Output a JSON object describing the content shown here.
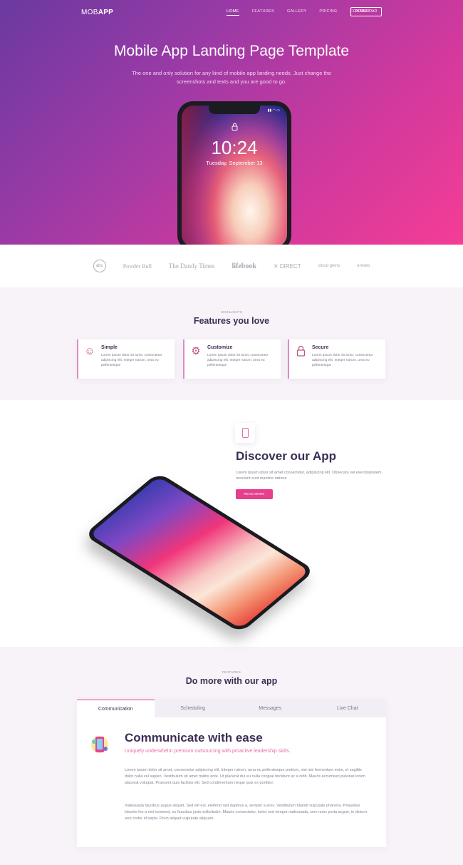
{
  "nav": {
    "logo_light": "MOB",
    "logo_bold": "APP",
    "links": [
      "HOME",
      "FEATURES",
      "GALLERY",
      "PRICING",
      "CONTACT"
    ],
    "download": "DOWNLOAD"
  },
  "hero": {
    "title": "Mobile App Landing Page Template",
    "subtitle": "The one and only solution for any kind of mobile app landing needs. Just change the screenshots and texts and you are good to go.",
    "phone_time": "10:24",
    "phone_date": "Tuesday, September 13",
    "phone_status": "▮▮ ◠ ▭",
    "lock_icon": "lock-icon"
  },
  "logos": [
    "abc",
    "Powder Bull",
    "The Dandy Times",
    "lifebook",
    "✕ DIRECT",
    "cloud gems",
    "envato"
  ],
  "features": {
    "small": "HIGHLIGHTS",
    "title": "Features you love",
    "items": [
      {
        "icon": "smile-icon",
        "glyph": "☺",
        "title": "Simple",
        "text": "Lorem ipsum dolor sit amet, consectetur adipiscing elit. Integer rutrum, urna eu pellentesque"
      },
      {
        "icon": "gear-icon",
        "glyph": "⚙",
        "title": "Customize",
        "text": "Lorem ipsum dolor sit amet, consectetur adipiscing elit. Integer rutrum, urna eu pellentesque"
      },
      {
        "icon": "lock-icon",
        "glyph": "🔒",
        "title": "Secure",
        "text": "Lorem ipsum dolor sit amet, consectetur adipiscing elit. Integer rutrum, urna eu pellentesque"
      }
    ]
  },
  "discover": {
    "title": "Discover our App",
    "text": "Lorem ipsum dolor sit amet consectetur, adipiscing elit. Obsecatu vel exercitationem nesciunt sunt maxime ratione",
    "button": "READ MORE"
  },
  "more": {
    "small": "FEATURES",
    "title": "Do more with our app",
    "tabs": [
      "Communication",
      "Scheduling",
      "Messages",
      "Live Chat"
    ],
    "content_title": "Communicate with ease",
    "content_subtitle": "Uniquely underwhelm premium outsourcing with proactive leadership skills.",
    "paragraph1": "Lorem ipsum dolor sit amet, consectetur adipiscing elit. Integer rutrum, urna eu pellentesque pretium, nisi nisi fermentum enim, et sagittis dolor nulla vel sapien. Vestibulum sit amet mattis ante. Ut placerat dui eu nulla congue tincidunt ac a nibh. Mauris accumsan pulvinar lorem placerat volutpat. Praesent quis facilisis elit. Sed condimentum neque quis ex porttitor.",
    "paragraph2": "malesuada faucibus augue aliquet. Sed elit est, eleifend sed dapibus a, semper a eros. Vestibulum blandit vulputate pharetra. Phasellus lobortis leo a nisl euismod, eu faucibus justo sollicitudin. Mauris consectetur, tortor sed tempor malesuada, sem nunc porta augue, in dictum arcu tortor id turpis. Proin aliquet vulputate aliquam."
  }
}
